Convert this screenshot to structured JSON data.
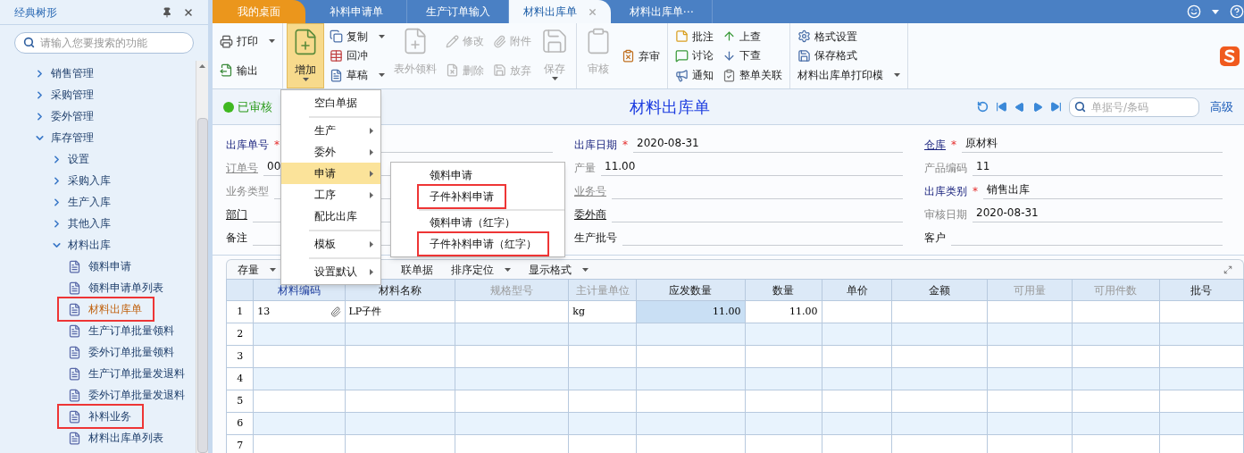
{
  "sidebar": {
    "title": "经典树形",
    "search": {
      "placeholder": "请输入您要搜索的功能"
    },
    "tree": [
      {
        "label": "销售管理",
        "kind": "folder",
        "expanded": false
      },
      {
        "label": "采购管理",
        "kind": "folder",
        "expanded": false
      },
      {
        "label": "委外管理",
        "kind": "folder",
        "expanded": false
      },
      {
        "label": "库存管理",
        "kind": "folder",
        "expanded": true,
        "children": [
          {
            "label": "设置",
            "kind": "folder",
            "expanded": false
          },
          {
            "label": "采购入库",
            "kind": "folder",
            "expanded": false
          },
          {
            "label": "生产入库",
            "kind": "folder",
            "expanded": false
          },
          {
            "label": "其他入库",
            "kind": "folder",
            "expanded": false
          },
          {
            "label": "材料出库",
            "kind": "folder",
            "expanded": true,
            "children": [
              {
                "label": "领料申请",
                "kind": "doc",
                "selected": false,
                "highlighted": false
              },
              {
                "label": "领料申请单列表",
                "kind": "doc",
                "selected": false,
                "highlighted": false
              },
              {
                "label": "材料出库单",
                "kind": "doc",
                "selected": true,
                "highlighted": true
              },
              {
                "label": "生产订单批量领料",
                "kind": "doc",
                "selected": false,
                "highlighted": false
              },
              {
                "label": "委外订单批量领料",
                "kind": "doc",
                "selected": false,
                "highlighted": false
              },
              {
                "label": "生产订单批量发退料",
                "kind": "doc",
                "selected": false,
                "highlighted": false
              },
              {
                "label": "委外订单批量发退料",
                "kind": "doc",
                "selected": false,
                "highlighted": false
              },
              {
                "label": "补料业务",
                "kind": "doc",
                "selected": false,
                "highlighted": true
              },
              {
                "label": "材料出库单列表",
                "kind": "doc",
                "selected": false,
                "highlighted": false
              }
            ]
          }
        ]
      }
    ]
  },
  "tabs": [
    {
      "label": "我的桌面",
      "kind": "home",
      "selected": false,
      "closable": false
    },
    {
      "label": "补料申请单",
      "kind": "doc",
      "selected": false,
      "closable": false
    },
    {
      "label": "生产订单输入",
      "kind": "doc",
      "selected": false,
      "closable": false
    },
    {
      "label": "材料出库单",
      "kind": "doc",
      "selected": true,
      "closable": true
    },
    {
      "label": "材料出库单⋯",
      "kind": "doc",
      "selected": false,
      "closable": false
    }
  ],
  "toolbar": [
    [
      {
        "kind": "stack",
        "buttons": [
          {
            "label": "打印",
            "dropdown": true,
            "disabled": false
          },
          {
            "label": "输出",
            "dropdown": false,
            "disabled": false
          }
        ]
      }
    ],
    [
      {
        "kind": "large",
        "label": "增加",
        "dropdown": true,
        "disabled": false,
        "pressed": true
      },
      {
        "kind": "stack",
        "buttons": [
          {
            "label": "复制",
            "dropdown": true,
            "disabled": false
          },
          {
            "label": "回冲",
            "dropdown": false,
            "disabled": false
          },
          {
            "label": "草稿",
            "dropdown": true,
            "disabled": false
          }
        ]
      },
      {
        "kind": "large",
        "label": "表外领料",
        "dropdown": false,
        "disabled": true,
        "pressed": false
      },
      {
        "kind": "stack",
        "buttons": [
          {
            "label": "修改",
            "dropdown": false,
            "disabled": true
          },
          {
            "label": "删除",
            "dropdown": false,
            "disabled": true
          }
        ]
      },
      {
        "kind": "stack",
        "buttons": [
          {
            "label": "附件",
            "dropdown": false,
            "disabled": true
          },
          {
            "label": "放弃",
            "dropdown": false,
            "disabled": true
          }
        ]
      },
      {
        "kind": "large",
        "label": "保存",
        "dropdown": true,
        "disabled": true,
        "pressed": false
      }
    ],
    [
      {
        "kind": "large",
        "label": "审核",
        "dropdown": false,
        "disabled": true,
        "pressed": false
      },
      {
        "kind": "stack",
        "buttons": [
          {
            "label": "弃审",
            "dropdown": false,
            "disabled": false
          }
        ]
      }
    ],
    [
      {
        "kind": "stack",
        "buttons": [
          {
            "label": "批注",
            "dropdown": false,
            "disabled": false
          },
          {
            "label": "讨论",
            "dropdown": false,
            "disabled": false
          },
          {
            "label": "通知",
            "dropdown": false,
            "disabled": false
          }
        ]
      },
      {
        "kind": "stack",
        "buttons": [
          {
            "label": "上查",
            "dropdown": false,
            "disabled": false
          },
          {
            "label": "下查",
            "dropdown": false,
            "disabled": false
          },
          {
            "label": "整单关联",
            "dropdown": false,
            "disabled": false
          }
        ]
      }
    ],
    [
      {
        "kind": "stack",
        "buttons": [
          {
            "label": "格式设置",
            "dropdown": false,
            "disabled": false
          },
          {
            "label": "保存格式",
            "dropdown": false,
            "disabled": false
          },
          {
            "label": "材料出库单打印模",
            "dropdown": true,
            "disabled": false
          }
        ]
      }
    ]
  ],
  "status": {
    "label": "已审核",
    "approved": true
  },
  "document_title": "材料出库单",
  "search": {
    "placeholder": "单据号/条码"
  },
  "advanced_link": "高级",
  "form": {
    "columns": [
      [
        {
          "label": "出库单号",
          "kind": "required",
          "mark": "*"
        },
        {
          "label": "订单号",
          "kind": "muted-link",
          "value": "00"
        },
        {
          "label": "业务类型",
          "kind": "muted"
        },
        {
          "label": "部门",
          "kind": "link"
        },
        {
          "label": "备注",
          "kind": "plain"
        }
      ],
      [
        {
          "label": "出库日期",
          "kind": "required",
          "mark": "*",
          "value": "2020-08-31"
        },
        {
          "label": "产量",
          "kind": "muted",
          "value": "11.00"
        },
        {
          "label": "业务号",
          "kind": "muted-link"
        },
        {
          "label": "委外商",
          "kind": "link"
        },
        {
          "label": "生产批号",
          "kind": "plain"
        }
      ],
      [
        {
          "label": "仓库",
          "kind": "required-link",
          "mark": "*",
          "value": "原材料"
        },
        {
          "label": "产品编码",
          "kind": "muted",
          "value": "11"
        },
        {
          "label": "出库类别",
          "kind": "required",
          "mark": "*",
          "value": "销售出库"
        },
        {
          "label": "审核日期",
          "kind": "muted",
          "value": "2020-08-31"
        },
        {
          "label": "客户",
          "kind": "plain"
        }
      ]
    ]
  },
  "grid": {
    "toolbar": [
      {
        "label": "存量",
        "dropdown": true
      },
      {
        "label": "联单据",
        "dropdown": false
      },
      {
        "label": "排序定位",
        "dropdown": true
      },
      {
        "label": "显示格式",
        "dropdown": true
      }
    ],
    "columns": [
      {
        "label": "材料编码",
        "kind": "key"
      },
      {
        "label": "材料名称",
        "kind": "normal"
      },
      {
        "label": "规格型号",
        "kind": "muted"
      },
      {
        "label": "主计量单位",
        "kind": "muted"
      },
      {
        "label": "应发数量",
        "kind": "normal"
      },
      {
        "label": "数量",
        "kind": "normal"
      },
      {
        "label": "单价",
        "kind": "normal"
      },
      {
        "label": "金额",
        "kind": "normal"
      },
      {
        "label": "可用量",
        "kind": "muted"
      },
      {
        "label": "可用件数",
        "kind": "muted"
      },
      {
        "label": "批号",
        "kind": "normal"
      }
    ],
    "rows": [
      {
        "number": "1",
        "cells": [
          {
            "kind": "text",
            "text": "13",
            "attachment": true,
            "selected": false
          },
          {
            "kind": "text",
            "text": "LP子件",
            "selected": false
          },
          {
            "kind": "text",
            "selected": false
          },
          {
            "kind": "text",
            "text": "kg",
            "selected": false
          },
          {
            "kind": "number",
            "text": "11.00",
            "selected": true
          },
          {
            "kind": "number",
            "text": "11.00",
            "selected": false
          }
        ]
      },
      {
        "number": "2"
      },
      {
        "number": "3"
      },
      {
        "number": "4"
      },
      {
        "number": "5"
      },
      {
        "number": "6"
      },
      {
        "number": "7"
      }
    ]
  },
  "add_menu": {
    "items": [
      {
        "kind": "item",
        "label": "空白单据",
        "submenu": false,
        "selected": false
      },
      {
        "kind": "separator"
      },
      {
        "kind": "item",
        "label": "生产",
        "submenu": true,
        "selected": false
      },
      {
        "kind": "item",
        "label": "委外",
        "submenu": true,
        "selected": false
      },
      {
        "kind": "item",
        "label": "申请",
        "submenu": true,
        "selected": true
      },
      {
        "kind": "item",
        "label": "工序",
        "submenu": true,
        "selected": false
      },
      {
        "kind": "item",
        "label": "配比出库",
        "submenu": false,
        "selected": false
      },
      {
        "kind": "separator"
      },
      {
        "kind": "item",
        "label": "模板",
        "submenu": true,
        "selected": false
      },
      {
        "kind": "separator"
      },
      {
        "kind": "item",
        "label": "设置默认",
        "submenu": true,
        "selected": false
      }
    ]
  },
  "apply_submenu": {
    "items": [
      {
        "kind": "item",
        "label": "领料申请",
        "highlighted": false
      },
      {
        "kind": "item",
        "label": "子件补料申请",
        "highlighted": true
      },
      {
        "kind": "separator"
      },
      {
        "kind": "item",
        "label": "领料申请（红字）",
        "highlighted": false
      },
      {
        "kind": "item",
        "label": "子件补料申请（红字）",
        "highlighted": true
      }
    ]
  }
}
